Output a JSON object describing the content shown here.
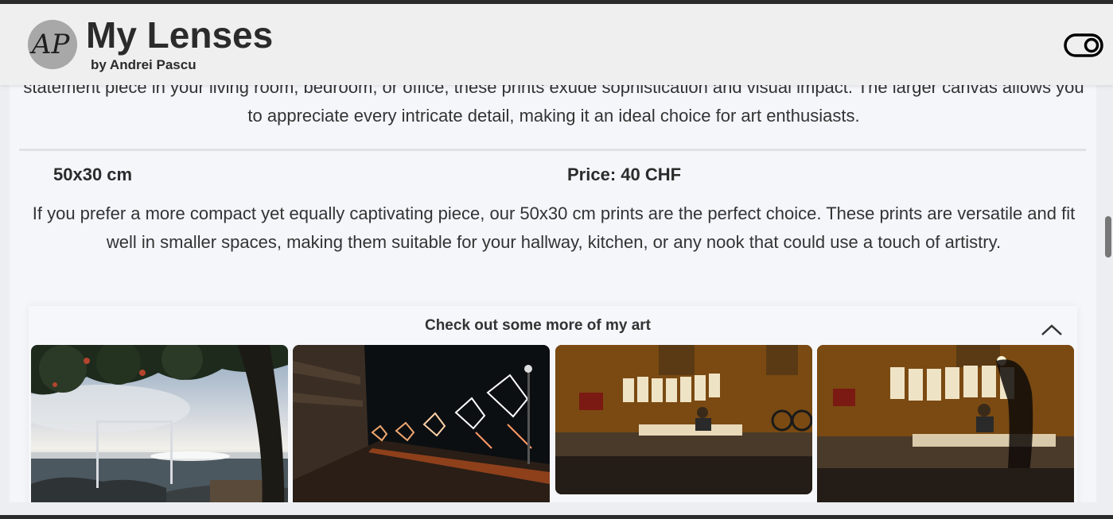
{
  "header": {
    "title": "My Lenses",
    "subtitle": "by Andrei Pascu",
    "logo_text": "AP",
    "theme_toggle_icon": "toggle-switch-icon"
  },
  "content": {
    "intro_text": "statement piece in your living room, bedroom, or office, these prints exude sophistication and visual impact. The larger canvas allows you to appreciate every intricate detail, making it an ideal choice for art enthusiasts.",
    "size_option": {
      "size": "50x30 cm",
      "price": "Price: 40 CHF",
      "description": "If you prefer a more compact yet equally captivating piece, our 50x30 cm prints are the perfect choice. These prints are versatile and fit well in smaller spaces, making them suitable for your hallway, kitchen, or any nook that could use a touch of artistry."
    }
  },
  "gallery": {
    "title": "Check out some more of my art",
    "collapse_icon": "chevron-up-icon",
    "images": [
      {
        "subject": "seaside sunset under tree"
      },
      {
        "subject": "night street with angel light decorations"
      },
      {
        "subject": "street artist at night with hanging paintings"
      },
      {
        "subject": "street artist at night with passing figure"
      }
    ]
  },
  "colors": {
    "page_background": "#f4f6fa",
    "header_background": "#efefef",
    "text": "#2b2b2b"
  }
}
